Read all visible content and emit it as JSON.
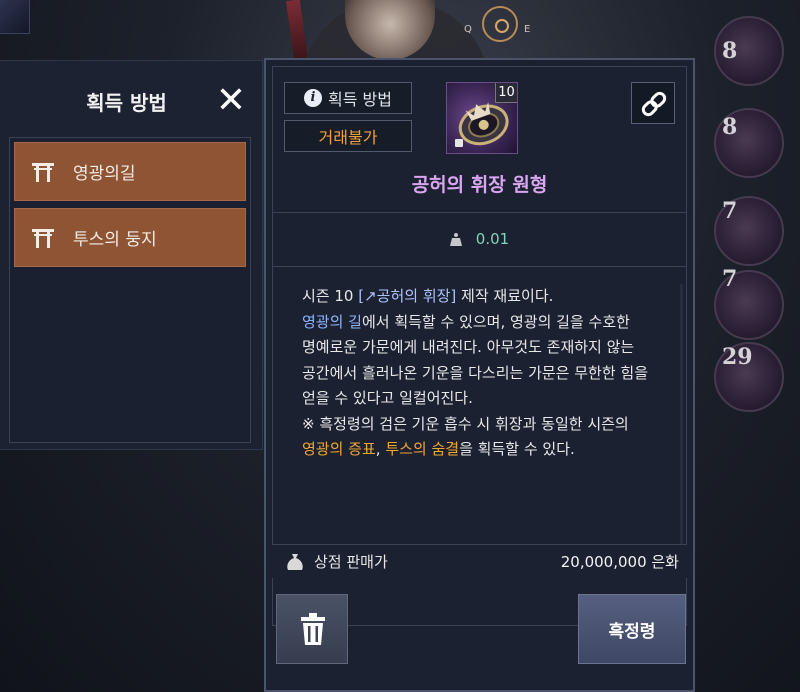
{
  "hud": {
    "compass_left": "Q",
    "compass_right": "E",
    "orb_levels": [
      "8",
      "8",
      "7",
      "7",
      "29"
    ]
  },
  "acquisition": {
    "title": "획득 방법",
    "items": [
      {
        "label": "영광의길"
      },
      {
        "label": "투스의 둥지"
      }
    ]
  },
  "item": {
    "acquire_chip": "획득 방법",
    "trade_chip": "거래불가",
    "level_badge": "10",
    "name": "공허의 휘장 원형",
    "weight": "0.01",
    "description": {
      "p1_prefix": "시즌 10 ",
      "p1_link": "[↗공허의 휘장]",
      "p1_suffix": " 제작 재료이다.",
      "p2_blue": "영광의 길",
      "p2_rest": "에서 획득할 수 있으며, 영광의 길을 수호한 명예로운 가문에게 내려진다. 아무것도 존재하지 않는 공간에서 흘러나온 기운을 다스리는 가문은 무한한 힘을 얻을 수 있다고 일컬어진다.",
      "p3_prefix": "※ 흑정령의 검은 기운 흡수 시 휘장과 동일한 시즌의 ",
      "p3_gold1": "영광의 증표",
      "p3_mid": ", ",
      "p3_gold2": "투스의 숨결",
      "p3_suffix": "을 획득할 수 있다."
    },
    "price_label": "상점 판매가",
    "price_value": "20,000,000 은화",
    "primary_button": "흑정령"
  },
  "colors": {
    "item_name": "#d9a6f0",
    "trade_chip": "#f0a633",
    "weight": "#7ed5b8",
    "acq_item_bg": "#8e5434"
  }
}
